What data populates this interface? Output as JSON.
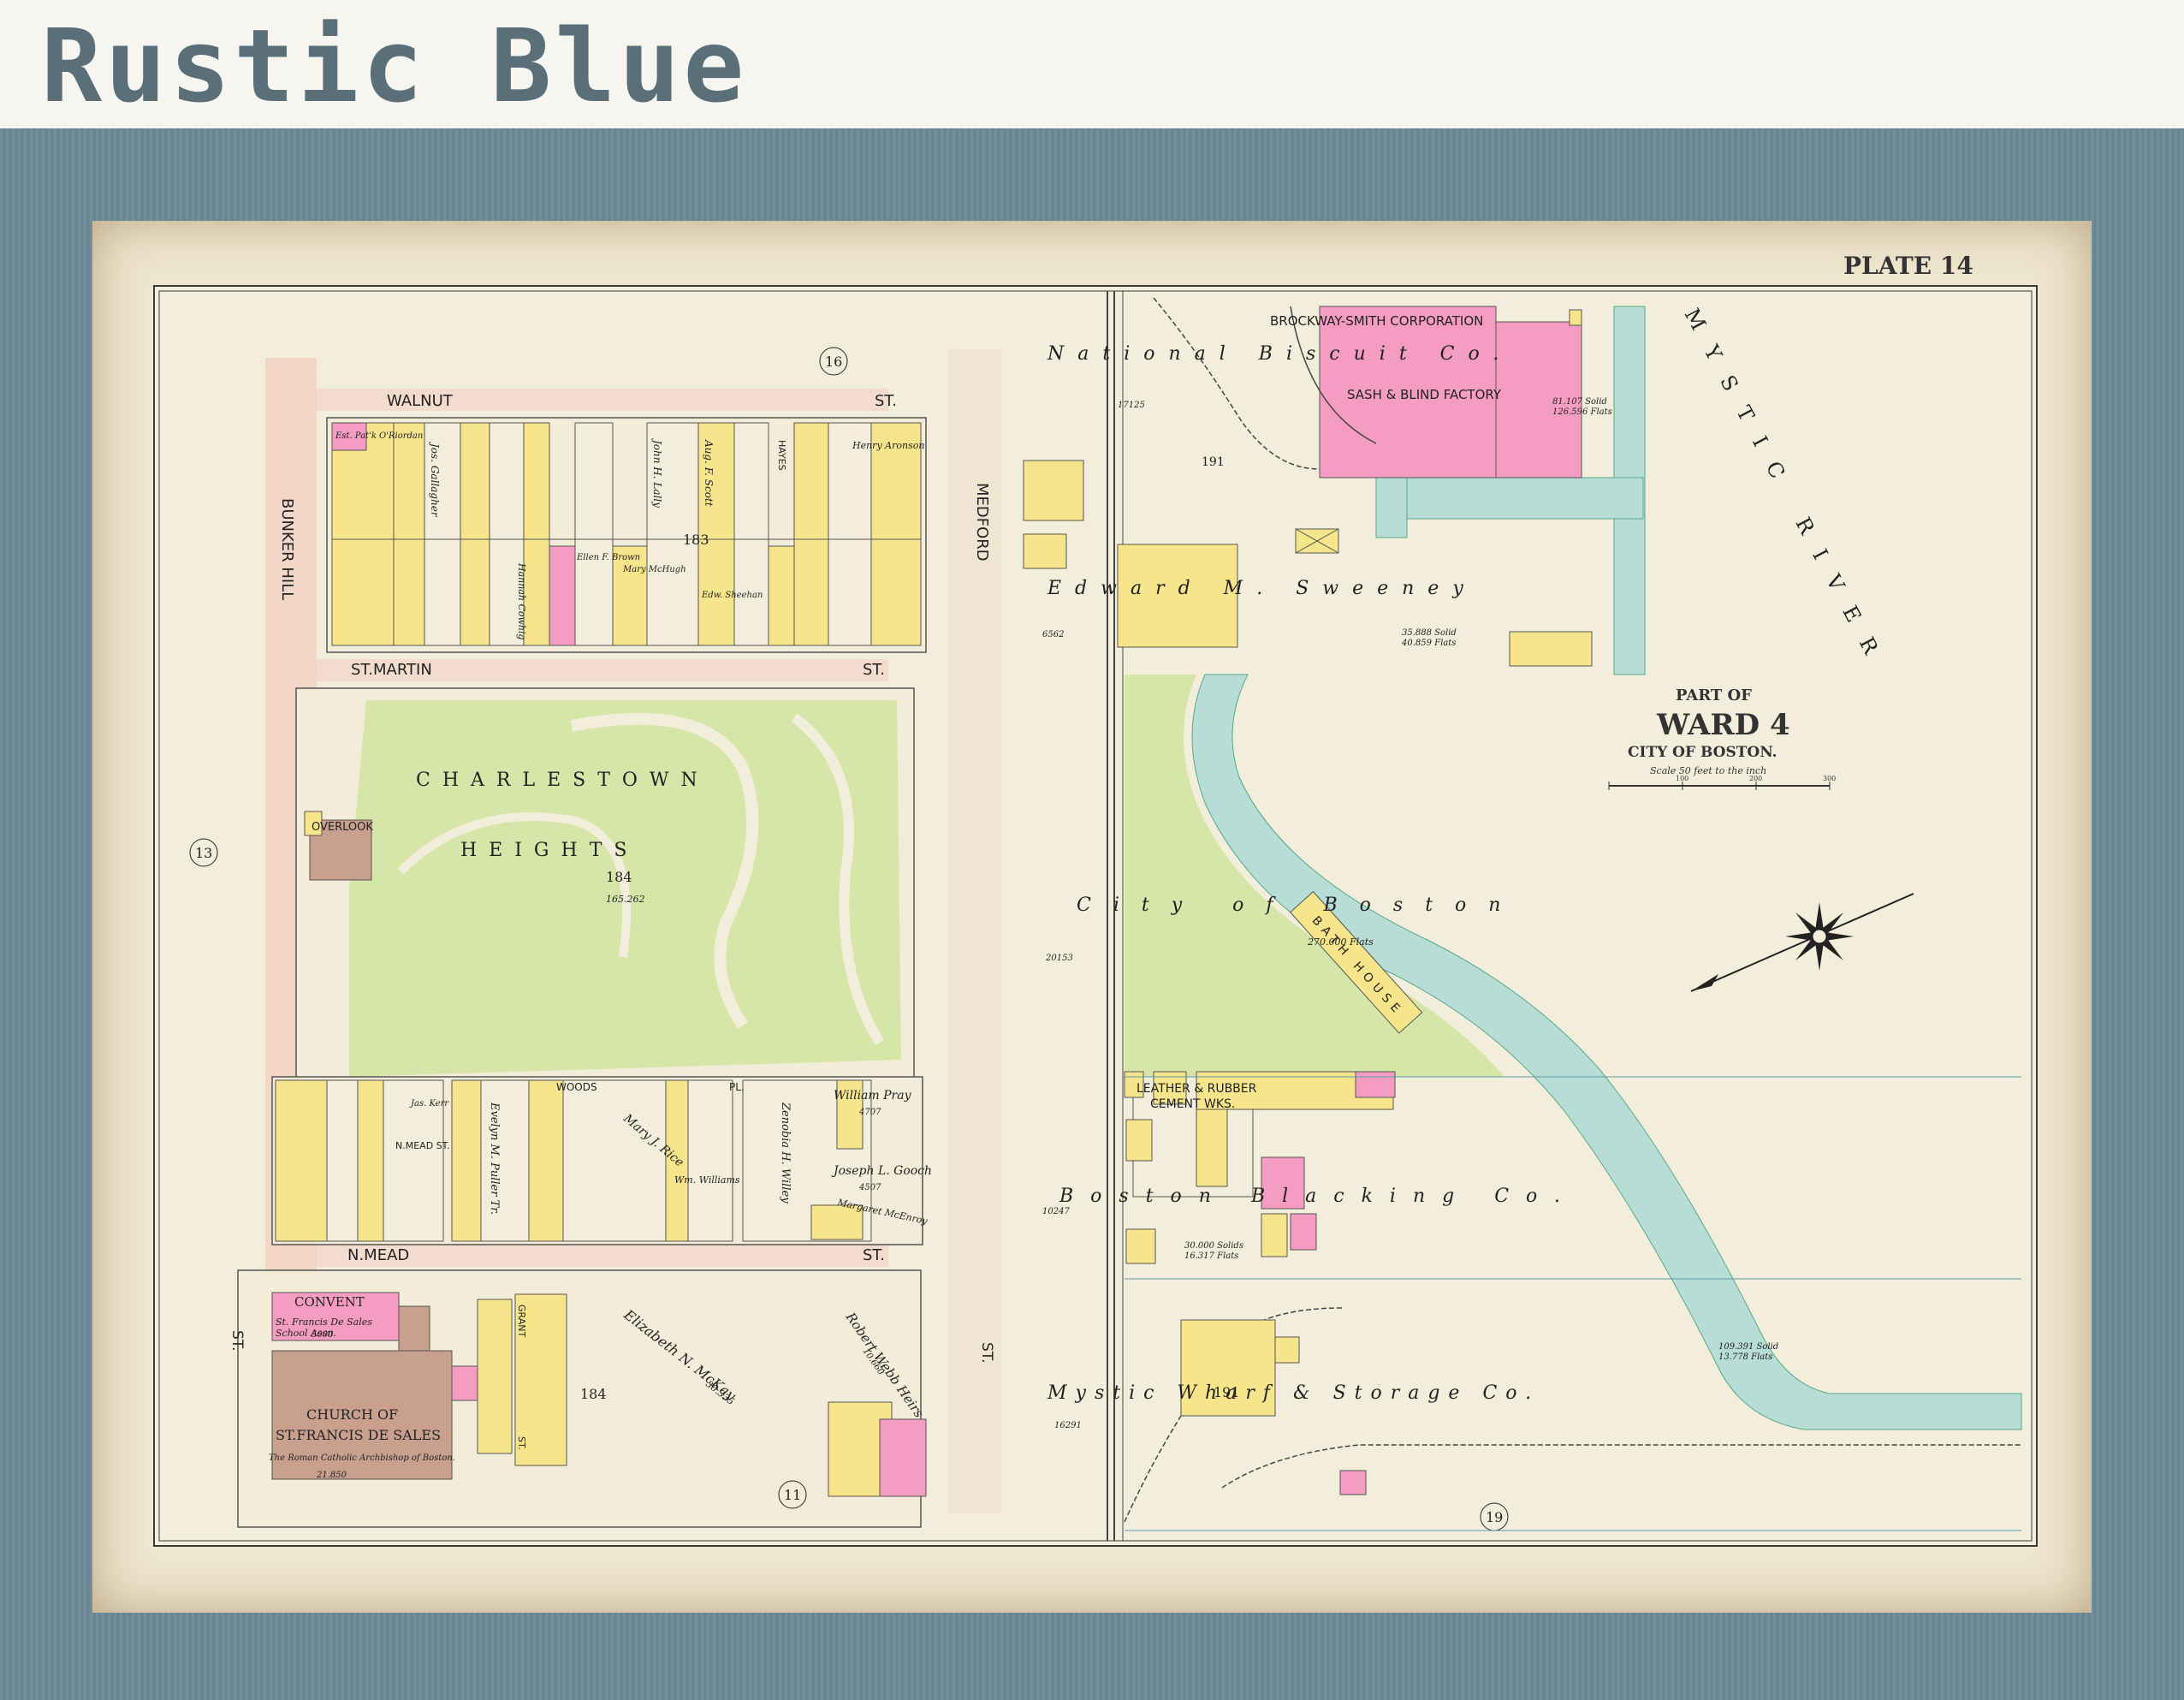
{
  "title": "Rustic Blue",
  "map": {
    "plate": "PLATE 14",
    "ward": {
      "part_of": "PART OF",
      "ward": "WARD 4",
      "city": "CITY OF BOSTON.",
      "scale": "Scale 50 feet to the inch",
      "scale_ticks": [
        "100",
        "200",
        "300"
      ]
    },
    "streets": {
      "walnut": "WALNUT",
      "walnut_st": "ST.",
      "st_martin": "ST.MARTIN",
      "st_martin_st": "ST.",
      "bunker_hill": "BUNKER HILL",
      "medford": "MEDFORD",
      "n_mead": "N.MEAD",
      "n_mead_st": "ST.",
      "woods_pl": "WOODS",
      "woods_pl_suffix": "PL.",
      "n_mead_inner": "N.MEAD ST.",
      "st_left": "ST.",
      "st_medford": "ST.",
      "grant_st": "GRANT",
      "grant_suffix": "ST."
    },
    "plate_refs": [
      "16",
      "13",
      "11",
      "19"
    ],
    "block_numbers": {
      "upper_block": "183",
      "park_block": "184",
      "lower_block": "184",
      "biscuit_block": "191",
      "wharf_block": "191"
    },
    "park": {
      "line1": "CHARLESTOWN",
      "line2": "HEIGHTS",
      "number": "184",
      "area": "165.262",
      "overlook": "OVERLOOK"
    },
    "labels": {
      "brockway": "BROCKWAY-SMITH CORPORATION",
      "sash": "SASH & BLIND FACTORY",
      "national_biscuit": "National Biscuit Co.",
      "biscuit_area": "81.107 Solid\n126.596 Flats",
      "sweeney": "Edward M. Sweeney",
      "sweeney_area": "35.888 Solid\n40.859 Flats",
      "sweeney_small": "6562",
      "area_17125": "17125",
      "mystic_river": "MYSTIC RIVER",
      "city_of_boston": "City of Boston",
      "city_flats": "270.000 Flats",
      "area_20153": "20153",
      "bath_house": "BATH HOUSE",
      "leather": "LEATHER & RUBBER",
      "cement": "CEMENT WKS.",
      "blacking": "Boston Blacking Co.",
      "blacking_area": "30.000 Solids\n16.317 Flats",
      "area_10247": "10247",
      "wharf": "Mystic Wharf & Storage Co.",
      "wharf_area": "109.391 Solid\n13.778 Flats",
      "area_16291": "16291",
      "convent": "CONVENT",
      "convent_sub": "St. Francis De Sales\nSchool Assn.",
      "convent_area": "5000",
      "church1": "CHURCH OF",
      "church2": "ST.FRANCIS DE SALES",
      "church_owner": "The Roman Catholic Archbishop of Boston.",
      "church_area": "21.850",
      "elizabeth": "Elizabeth N. McKay",
      "elizabeth_area": "36.335",
      "robert_webb": "Robert Webb Heirs",
      "robert_area": "10.660",
      "william_pray": "William Pray",
      "william_pray_area": "4707",
      "joseph_gooch": "Joseph L. Gooch",
      "joseph_area": "4507",
      "mary_rice": "Mary J. Rice",
      "zenobia": "Zenobia H. Willey",
      "evelyn": "Evelyn M. Puller Tr.",
      "john_lally": "John H. Lally",
      "aug_scott": "Aug. F. Scott",
      "hayes": "HAYES",
      "henry_aronson": "Henry Aronson",
      "est_riordan": "Est. Pat'k O'Riordan",
      "jos_gallagher": "Jos. Gallagher",
      "mary_mchugh": "Mary McHugh",
      "ellen_brown": "Ellen F. Brown",
      "edward_sheehan": "Edw. Sheehan",
      "wm_williams": "Wm. Williams",
      "jas_kerr": "Jas. Kerr",
      "hannah_cowhig": "Hannah Cowhig",
      "margaret_mcenroy": "Margaret McEnroy"
    },
    "colors": {
      "paper": "#f3eedb",
      "brick_pink": "#f59cc3",
      "wood_yellow": "#f6e58a",
      "park_green": "#d6e6a8",
      "river_blue": "#b8ddd6",
      "stone_brown": "#c9a08e",
      "street_pink": "#f3d7c7"
    }
  }
}
